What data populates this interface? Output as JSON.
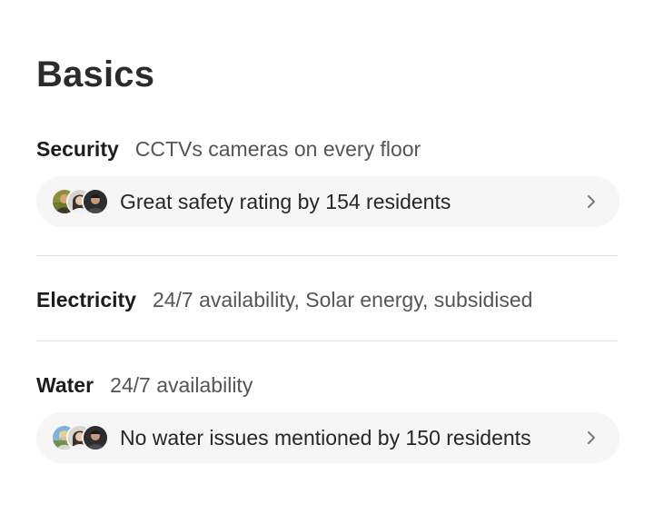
{
  "section": {
    "title": "Basics"
  },
  "rows": {
    "security": {
      "label": "Security",
      "value": "CCTVs cameras on every floor",
      "insight": "Great safety rating by 154 residents"
    },
    "electricity": {
      "label": "Electricity",
      "value": "24/7 availability, Solar energy, subsidised"
    },
    "water": {
      "label": "Water",
      "value": "24/7 availability",
      "insight": "No water issues mentioned by 150 residents"
    }
  },
  "icons": {
    "chevron": "chevron-right-icon",
    "avatar": "resident-avatar"
  },
  "colors": {
    "pill_background": "#f6f6f6",
    "divider": "#e4e4e4",
    "label_text": "#1c1c1c",
    "value_text": "#555555"
  }
}
